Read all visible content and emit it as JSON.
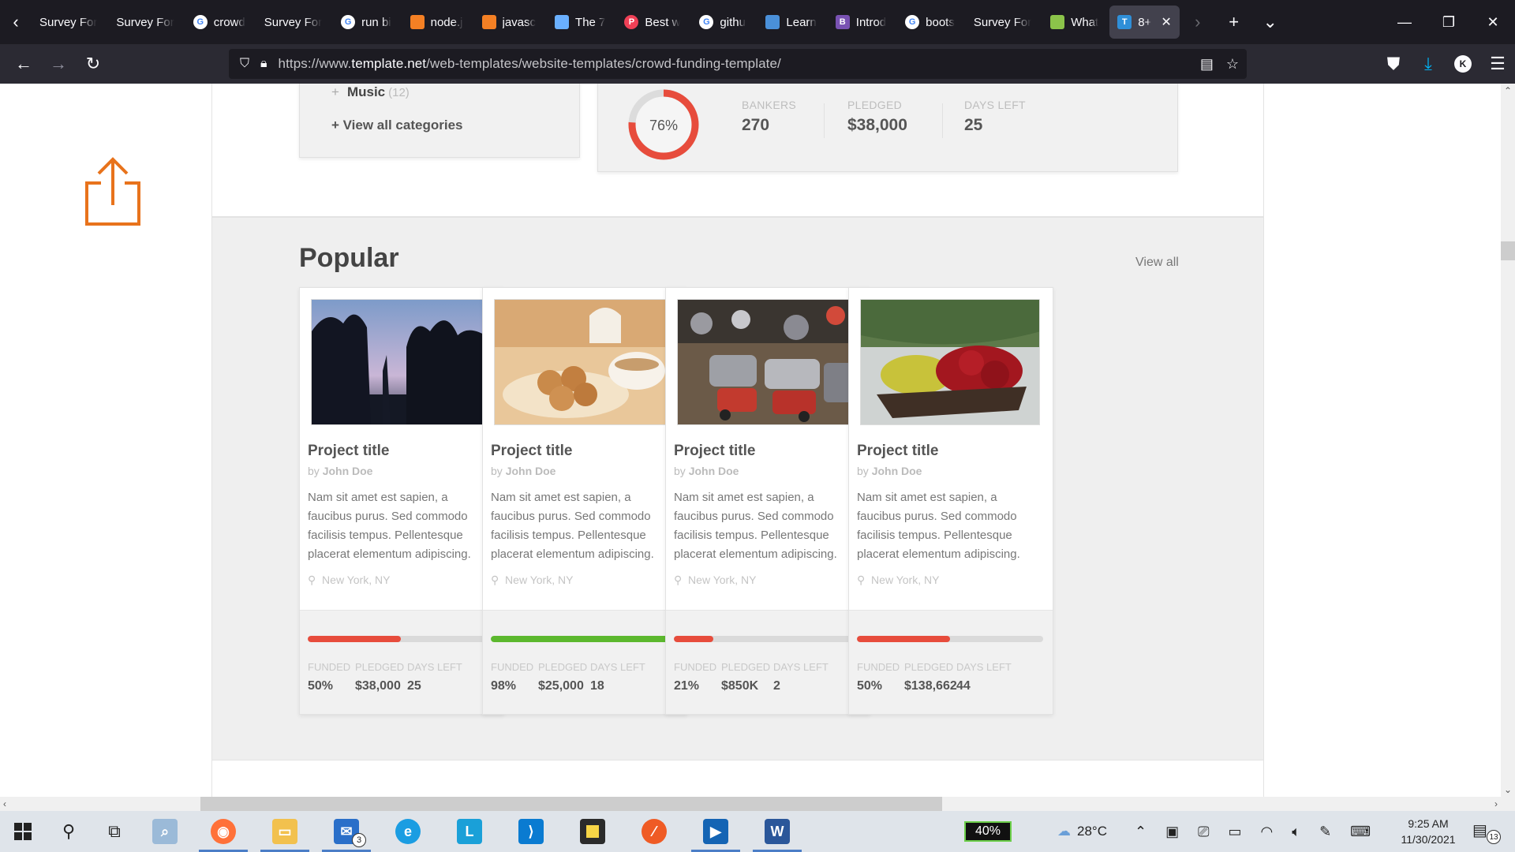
{
  "browser": {
    "tabs": [
      {
        "label": "Survey For",
        "favicon": "none",
        "color": "#1c1b22"
      },
      {
        "label": "Survey For",
        "favicon": "none",
        "color": "#1c1b22"
      },
      {
        "label": "crowd",
        "favicon": "google-icon",
        "color": "#ffffff"
      },
      {
        "label": "Survey For",
        "favicon": "none",
        "color": "#1c1b22"
      },
      {
        "label": "run bi",
        "favicon": "google-icon",
        "color": "#ffffff"
      },
      {
        "label": "node.j",
        "favicon": "stackoverflow-icon",
        "color": "#f48024"
      },
      {
        "label": "javasc",
        "favicon": "stackoverflow-icon",
        "color": "#f48024"
      },
      {
        "label": "The 7",
        "favicon": "bookmark-icon",
        "color": "#6ab0ff"
      },
      {
        "label": "Best w",
        "favicon": "pocket-icon",
        "color": "#ef4056"
      },
      {
        "label": "githu",
        "favicon": "google-icon",
        "color": "#ffffff"
      },
      {
        "label": "Learn",
        "favicon": "doc-icon",
        "color": "#4a90d9"
      },
      {
        "label": "Introd",
        "favicon": "bootstrap-icon",
        "color": "#7952b3"
      },
      {
        "label": "boots",
        "favicon": "google-icon",
        "color": "#ffffff"
      },
      {
        "label": "Survey For",
        "favicon": "none",
        "color": "#1c1b22"
      },
      {
        "label": "What",
        "favicon": "flag-icon",
        "color": "#8bc34a"
      },
      {
        "label": "8+",
        "favicon": "template-icon",
        "color": "#2f8fd8",
        "active": true
      }
    ],
    "url": {
      "prefix": "https://www.",
      "domain": "template.net",
      "path": "/web-templates/website-templates/crowd-funding-template/"
    },
    "profile_initial": "K"
  },
  "page": {
    "categories": {
      "last_item": "Music",
      "last_count": "(12)",
      "view_all": "+ View all categories"
    },
    "featured": {
      "funded_percent": "76%",
      "funded_fraction": 0.76,
      "stats": [
        {
          "label": "BANKERS",
          "value": "270"
        },
        {
          "label": "PLEDGED",
          "value": "$38,000"
        },
        {
          "label": "DAYS LEFT",
          "value": "25"
        }
      ]
    },
    "popular": {
      "title": "Popular",
      "view_all": "View all",
      "cards": [
        {
          "title": "Project title",
          "by": "by",
          "author": "John Doe",
          "description": "Nam sit amet est sapien, a faucibus purus. Sed commodo facilisis tempus. Pellentesque placerat elementum adipiscing.",
          "location": "New York, NY",
          "progress": 0.5,
          "bar_color": "#e74c3c",
          "stats": [
            {
              "label": "FUNDED",
              "value": "50%"
            },
            {
              "label": "PLEDGED",
              "value": "$38,000"
            },
            {
              "label": "DAYS LEFT",
              "value": "25"
            }
          ],
          "image": "trees-at-dusk"
        },
        {
          "title": "Project title",
          "by": "by",
          "author": "John Doe",
          "description": "Nam sit amet est sapien, a faucibus purus. Sed commodo facilisis tempus. Pellentesque placerat elementum adipiscing.",
          "location": "New York, NY",
          "progress": 0.98,
          "bar_color": "#5cb82e",
          "stats": [
            {
              "label": "FUNDED",
              "value": "98%"
            },
            {
              "label": "PLEDGED",
              "value": "$25,000"
            },
            {
              "label": "DAYS LEFT",
              "value": "18"
            }
          ],
          "image": "pastries-and-tea"
        },
        {
          "title": "Project title",
          "by": "by",
          "author": "John Doe",
          "description": "Nam sit amet est sapien, a faucibus purus. Sed commodo facilisis tempus. Pellentesque placerat elementum adipiscing.",
          "location": "New York, NY",
          "progress": 0.21,
          "bar_color": "#e74c3c",
          "stats": [
            {
              "label": "FUNDED",
              "value": "21%"
            },
            {
              "label": "PLEDGED",
              "value": "$850K"
            },
            {
              "label": "DAYS LEFT",
              "value": "2"
            }
          ],
          "image": "toy-cars"
        },
        {
          "title": "Project title",
          "by": "by",
          "author": "John Doe",
          "description": "Nam sit amet est sapien, a faucibus purus. Sed commodo facilisis tempus. Pellentesque placerat elementum adipiscing.",
          "location": "New York, NY",
          "progress": 0.5,
          "bar_color": "#e74c3c",
          "stats": [
            {
              "label": "FUNDED",
              "value": "50%"
            },
            {
              "label": "PLEDGED",
              "value": "$138,662"
            },
            {
              "label": "DAYS LEFT",
              "value": "44"
            }
          ],
          "image": "flower-cart"
        }
      ]
    }
  },
  "taskbar": {
    "mail_badge": "3",
    "battery": "40%",
    "temperature": "28°C",
    "time": "9:25 AM",
    "date": "11/30/2021",
    "notifications": "13"
  },
  "colors": {
    "accent_orange": "#e8731c",
    "donut_red": "#e74c3c"
  }
}
